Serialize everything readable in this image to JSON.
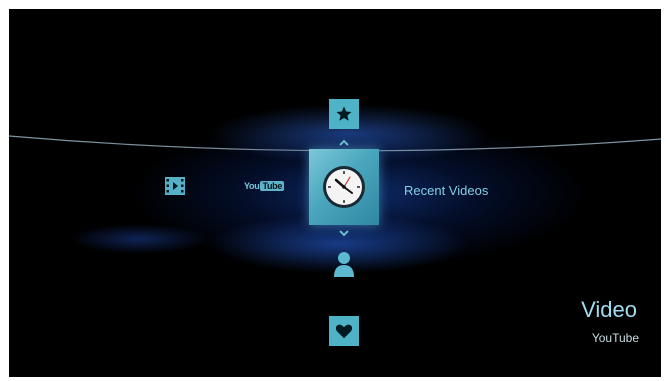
{
  "menu": {
    "up_icon": "star-icon",
    "down_icon": "user-icon",
    "bottom_icon": "heart-icon",
    "selected_icon": "clock-icon",
    "selected_label": "Recent Videos",
    "left_items": [
      {
        "icon": "film-icon"
      },
      {
        "icon": "youtube-logo",
        "logo_text_you": "You",
        "logo_text_tube": "Tube"
      }
    ]
  },
  "category": {
    "title": "Video",
    "subtitle": "YouTube"
  },
  "colors": {
    "accent": "#4fb3c8",
    "label": "#86cfe2",
    "background": "#000000",
    "glow": "#1e50be"
  }
}
